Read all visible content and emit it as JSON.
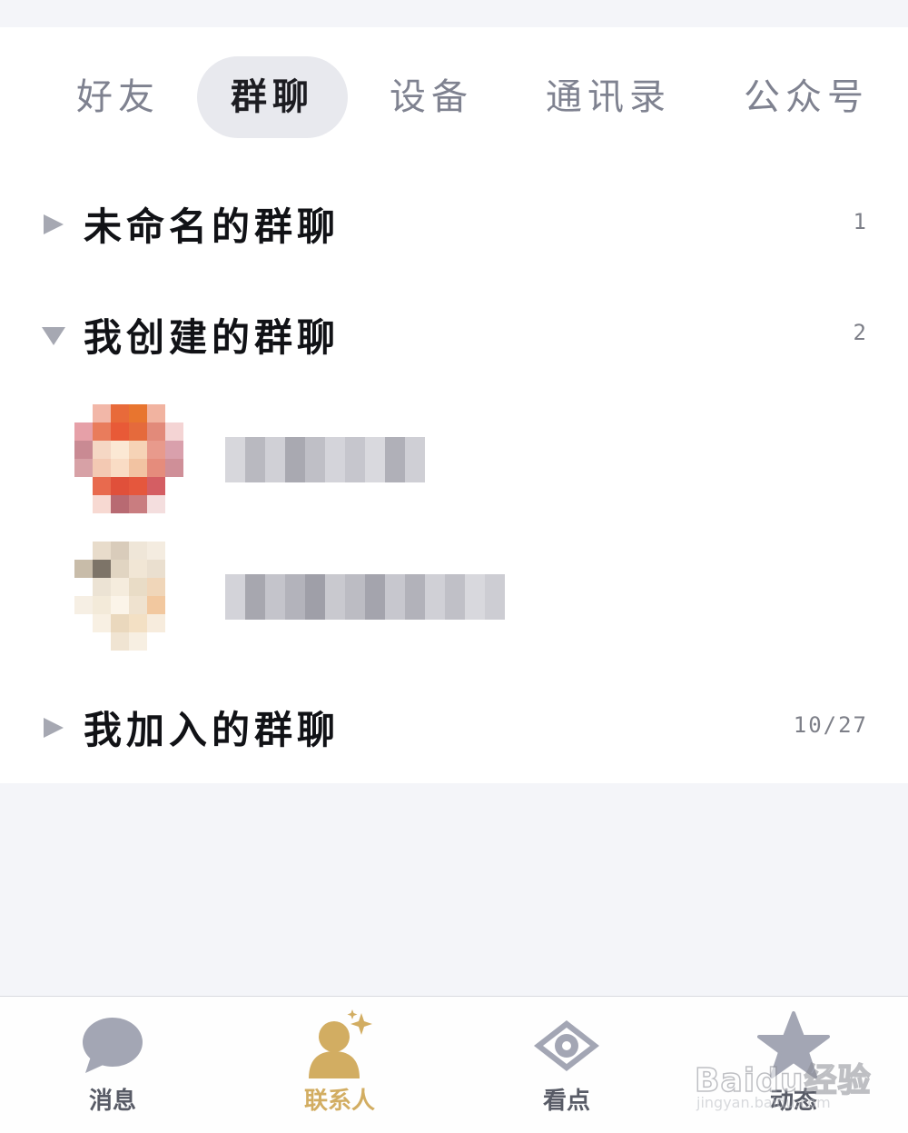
{
  "tabs": [
    {
      "label": "好友",
      "active": false
    },
    {
      "label": "群聊",
      "active": true
    },
    {
      "label": "设备",
      "active": false
    },
    {
      "label": "通讯录",
      "active": false
    },
    {
      "label": "公众号",
      "active": false
    }
  ],
  "groups": [
    {
      "title": "未命名的群聊",
      "count": "1",
      "expanded": false
    },
    {
      "title": "我创建的群聊",
      "count": "2",
      "expanded": true
    },
    {
      "title": "我加入的群聊",
      "count": "10/27",
      "expanded": false
    }
  ],
  "bottom_nav": [
    {
      "label": "消息",
      "icon": "chat-bubble-icon",
      "active": false
    },
    {
      "label": "联系人",
      "icon": "contacts-person-icon",
      "active": true
    },
    {
      "label": "看点",
      "icon": "eye-icon",
      "active": false
    },
    {
      "label": "动态",
      "icon": "star-icon",
      "active": false
    }
  ],
  "watermark": {
    "main": "Baidu经验",
    "sub": "jingyan.baidu.com"
  },
  "colors": {
    "accent": "#d2ad62",
    "active_tab_bg": "#e8e9ee",
    "page_bg": "#f4f5f9"
  }
}
